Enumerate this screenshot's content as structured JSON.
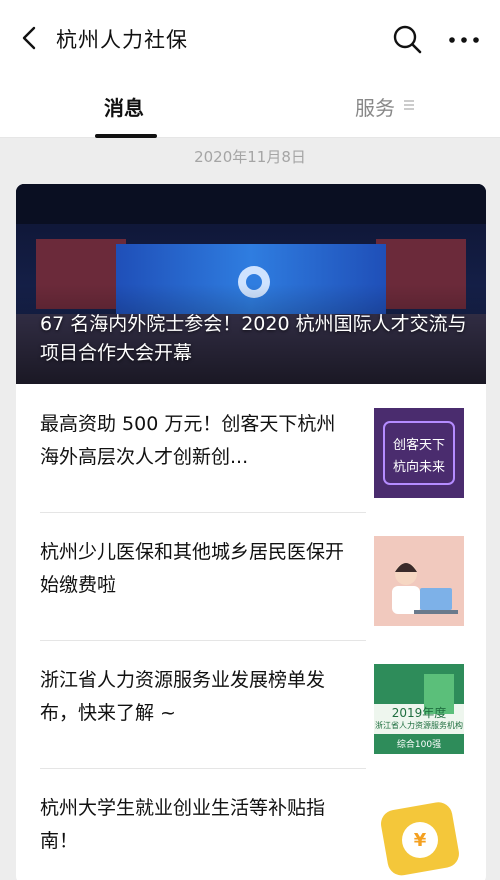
{
  "header": {
    "title": "杭州人力社保"
  },
  "tabs": [
    {
      "label": "消息",
      "active": true
    },
    {
      "label": "服务",
      "active": false
    }
  ],
  "date": "2020年11月8日",
  "hero": {
    "title": "67 名海内外院士参会！2020 杭州国际人才交流与项目合作大会开幕"
  },
  "articles": [
    {
      "title": "最高资助 500 万元！创客天下杭州海外高层次人才创新创...",
      "thumb_text": [
        "创客天下",
        "杭向未来"
      ]
    },
    {
      "title": "杭州少儿医保和其他城乡居民医保开始缴费啦"
    },
    {
      "title": "浙江省人力资源服务业发展榜单发布，快来了解 ~",
      "thumb_text": [
        "2019年度",
        "浙江省人力资源服务机构",
        "综合100强"
      ]
    },
    {
      "title": "杭州大学生就业创业生活等补贴指南！",
      "thumb_text": [
        "¥"
      ]
    }
  ],
  "colors": {
    "page_bg": "#ededed",
    "card_bg": "#ffffff",
    "thumb1_bg": "#4a2c6e",
    "thumb2_bg": "#f1c9be",
    "thumb3_bg": "#2e8c5a",
    "thumb4_bg": "#f4c73a"
  }
}
